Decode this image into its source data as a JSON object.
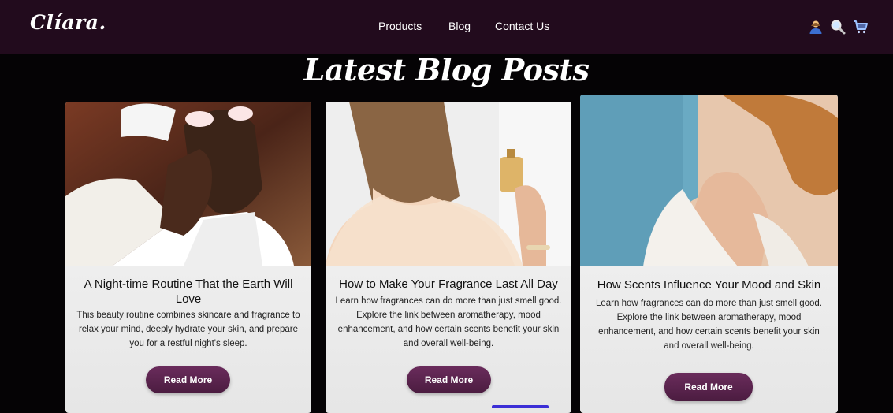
{
  "brand": {
    "logo": "Clíara."
  },
  "nav": {
    "links": [
      "Products",
      "Blog",
      "Contact Us"
    ],
    "icons": [
      "user-icon",
      "search-icon",
      "cart-icon"
    ]
  },
  "page": {
    "title": "Latest Blog Posts"
  },
  "posts": [
    {
      "title": "A Night-time Routine That the Earth Will Love",
      "excerpt": "This beauty routine combines skincare and fragrance to relax your mind, deeply hydrate your skin, and prepare you for a restful night's sleep.",
      "button": "Read More",
      "image": "woman-with-under-eye-patches-photo"
    },
    {
      "title": "How to Make Your Fragrance Last All Day",
      "excerpt": "Learn how fragrances can do more than just smell good. Explore the link between aromatherapy, mood enhancement, and how certain scents benefit your skin and overall well-being.",
      "button": "Read More",
      "image": "woman-spraying-perfume-photo"
    },
    {
      "title": "How Scents Influence Your Mood and Skin",
      "excerpt": "Learn how fragrances can do more than just smell good. Explore the link between aromatherapy, mood enhancement, and how certain scents benefit your skin and overall well-being.",
      "button": "Read More",
      "image": "woman-smelling-wrist-photo"
    }
  ],
  "colors": {
    "navbar": "#220b1d",
    "background": "#050305",
    "button": "#5c2450",
    "card": "#f2f2f2"
  }
}
